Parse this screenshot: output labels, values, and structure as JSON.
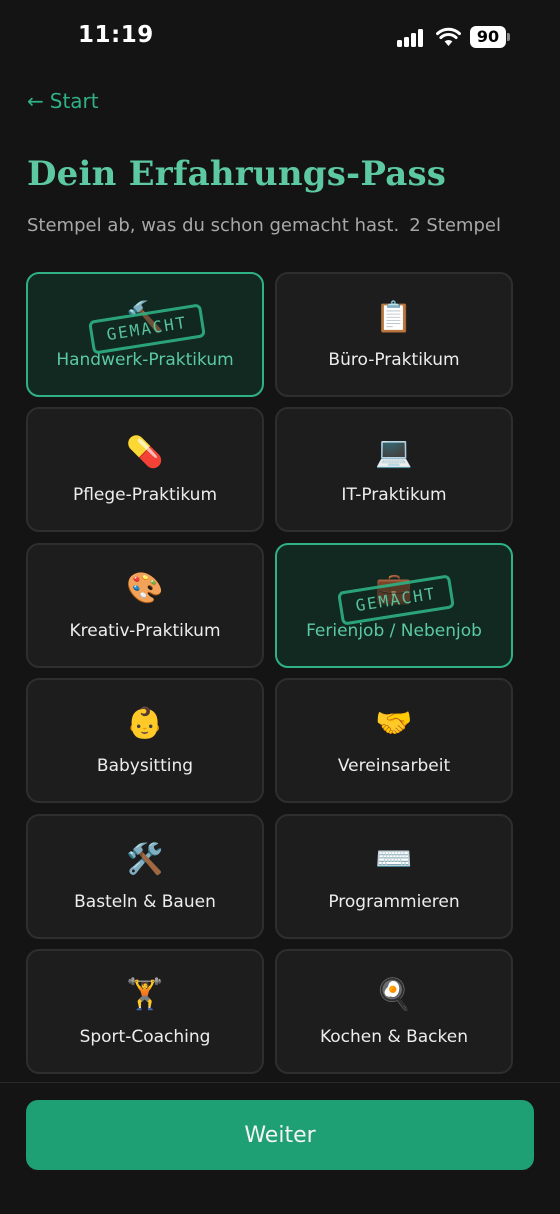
{
  "status_bar": {
    "time": "11:19",
    "battery": "90"
  },
  "header": {
    "back_label": "Start",
    "title": "Dein Erfahrungs-Pass",
    "subtitle": "Stempel ab, was du schon gemacht hast.",
    "stamp_count": "2 Stempel"
  },
  "stamp_label": "GEMACHT",
  "experiences": [
    {
      "label": "Handwerk-Praktikum",
      "emoji": "🔨",
      "icon": "hammer-icon",
      "done": true
    },
    {
      "label": "Büro-Praktikum",
      "emoji": "📋",
      "icon": "clipboard-icon",
      "done": false
    },
    {
      "label": "Pflege-Praktikum",
      "emoji": "💊",
      "icon": "pill-icon",
      "done": false
    },
    {
      "label": "IT-Praktikum",
      "emoji": "💻",
      "icon": "laptop-icon",
      "done": false
    },
    {
      "label": "Kreativ-Praktikum",
      "emoji": "🎨",
      "icon": "palette-icon",
      "done": false
    },
    {
      "label": "Ferienjob / Nebenjob",
      "emoji": "💼",
      "icon": "briefcase-icon",
      "done": true
    },
    {
      "label": "Babysitting",
      "emoji": "👶",
      "icon": "baby-icon",
      "done": false
    },
    {
      "label": "Vereinsarbeit",
      "emoji": "🤝",
      "icon": "handshake-icon",
      "done": false
    },
    {
      "label": "Basteln & Bauen",
      "emoji": "🛠️",
      "icon": "tools-icon",
      "done": false
    },
    {
      "label": "Programmieren",
      "emoji": "⌨️",
      "icon": "keyboard-icon",
      "done": false
    },
    {
      "label": "Sport-Coaching",
      "emoji": "🏋️",
      "icon": "weightlifter-icon",
      "done": false
    },
    {
      "label": "Kochen & Backen",
      "emoji": "🍳",
      "icon": "frying-pan-icon",
      "done": false
    }
  ],
  "footer": {
    "continue_label": "Weiter"
  },
  "colors": {
    "accent": "#2fb184",
    "accent_light": "#5cc9a2",
    "button": "#1e9f74",
    "background": "#141414",
    "card": "#1d1d1d",
    "card_done": "#112921"
  }
}
